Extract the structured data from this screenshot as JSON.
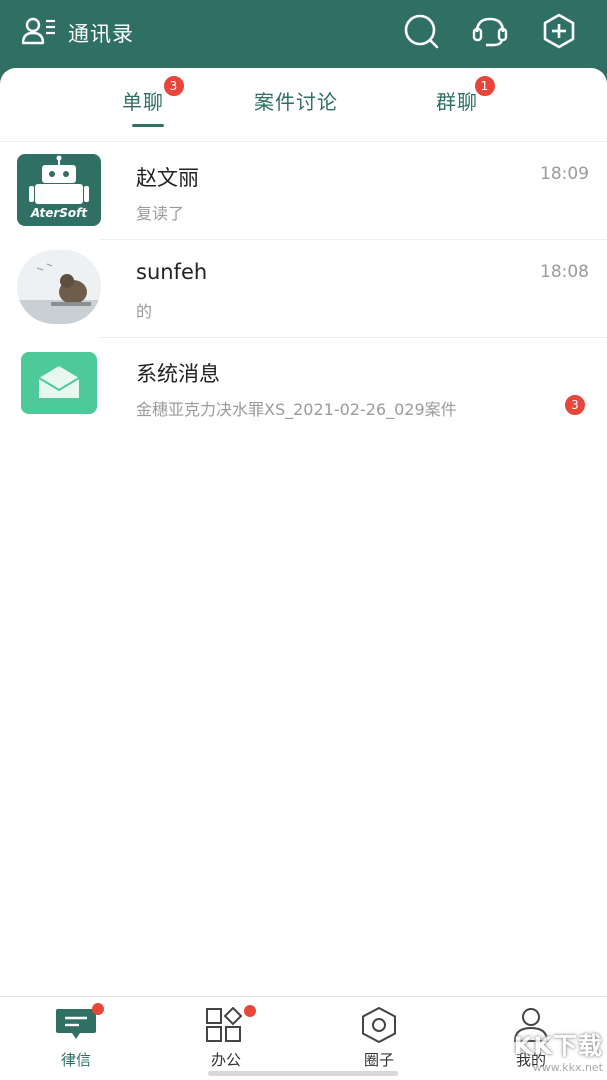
{
  "header": {
    "contacts_label": "通讯录",
    "icons": [
      "contacts-icon",
      "search-icon",
      "headset-icon",
      "add-icon"
    ]
  },
  "tabs": [
    {
      "label": "单聊",
      "badge": "3",
      "active": true
    },
    {
      "label": "案件讨论",
      "badge": "",
      "active": false
    },
    {
      "label": "群聊",
      "badge": "1",
      "active": false
    }
  ],
  "chats": [
    {
      "name": "赵文丽",
      "time": "18:09",
      "preview": "复读了",
      "avatar_text": "AterSoft",
      "unread": ""
    },
    {
      "name": "sunfeh",
      "time": "18:08",
      "preview": "的",
      "avatar_text": "",
      "unread": ""
    },
    {
      "name": "系统消息",
      "time": "",
      "preview": "金穗亚克力决水罪XS_2021-02-26_029案件",
      "avatar_text": "",
      "unread": "3"
    }
  ],
  "bottom_nav": [
    {
      "label": "律信",
      "icon": "chat-icon",
      "active": true,
      "dot": true
    },
    {
      "label": "办公",
      "icon": "apps-icon",
      "active": false,
      "dot": true
    },
    {
      "label": "圈子",
      "icon": "circle-icon",
      "active": false,
      "dot": false
    },
    {
      "label": "我的",
      "icon": "profile-icon",
      "active": false,
      "dot": false
    }
  ],
  "watermark": {
    "logo": "KK下载",
    "url": "www.kkx.net"
  },
  "colors": {
    "brand": "#2f6f64",
    "badge": "#e8463a",
    "muted": "#9b9b9b"
  }
}
